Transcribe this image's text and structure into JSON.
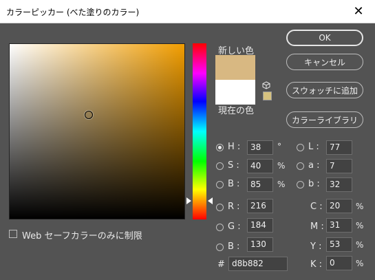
{
  "window": {
    "title": "カラーピッカー (べた塗りのカラー)",
    "close": "✕"
  },
  "labels": {
    "new": "新しい色",
    "current": "現在の色"
  },
  "buttons": {
    "ok": "OK",
    "cancel": "キャンセル",
    "add_swatch": "スウォッチに追加",
    "libraries": "カラーライブラリ"
  },
  "colors": {
    "new": "#d8b882",
    "current": "#ffffff",
    "web_safe_swatch": "#d6c27f"
  },
  "hsb": {
    "h": {
      "label": "H :",
      "value": "38",
      "unit": "°"
    },
    "s": {
      "label": "S :",
      "value": "40",
      "unit": "%"
    },
    "b": {
      "label": "B :",
      "value": "85",
      "unit": "%"
    }
  },
  "rgb": {
    "r": {
      "label": "R :",
      "value": "216"
    },
    "g": {
      "label": "G :",
      "value": "184"
    },
    "b": {
      "label": "B :",
      "value": "130"
    }
  },
  "lab": {
    "l": {
      "label": "L :",
      "value": "77"
    },
    "a": {
      "label": "a :",
      "value": "7"
    },
    "b": {
      "label": "b :",
      "value": "32"
    }
  },
  "cmyk": {
    "c": {
      "label": "C :",
      "value": "20",
      "unit": "%"
    },
    "m": {
      "label": "M :",
      "value": "31",
      "unit": "%"
    },
    "y": {
      "label": "Y :",
      "value": "53",
      "unit": "%"
    },
    "k": {
      "label": "K :",
      "value": "0",
      "unit": "%"
    }
  },
  "hex": {
    "label": "#",
    "value": "d8b882"
  },
  "web_only": {
    "label": "Web セーフカラーのみに制限",
    "checked": false
  }
}
